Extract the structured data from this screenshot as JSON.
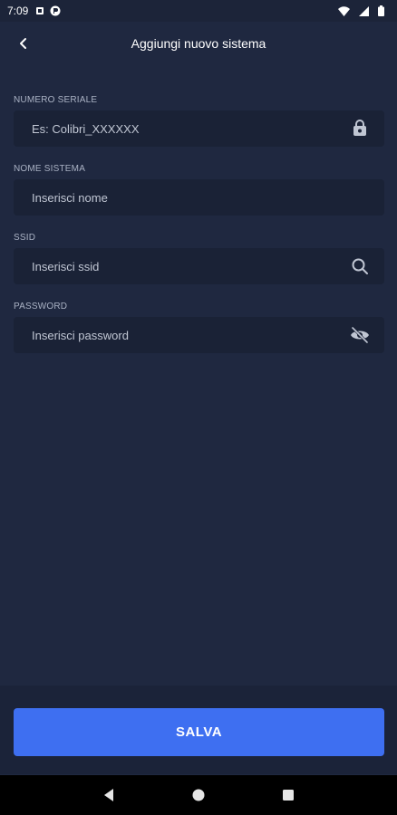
{
  "status_bar": {
    "time": "7:09",
    "icons": [
      "notification-icon",
      "app-icon",
      "wifi-icon",
      "signal-icon",
      "battery-icon"
    ]
  },
  "header": {
    "title": "Aggiungi nuovo sistema",
    "back_icon": "chevron-left-icon"
  },
  "fields": {
    "serial": {
      "label": "NUMERO SERIALE",
      "placeholder": "Es: Colibri_XXXXXX",
      "icon": "lock-icon"
    },
    "name": {
      "label": "NOME SISTEMA",
      "placeholder": "Inserisci nome"
    },
    "ssid": {
      "label": "SSID",
      "placeholder": "Inserisci ssid",
      "icon": "search-icon"
    },
    "password": {
      "label": "PASSWORD",
      "placeholder": "Inserisci password",
      "icon": "eye-off-icon"
    }
  },
  "actions": {
    "save_label": "SALVA"
  },
  "colors": {
    "background": "#1f2840",
    "field_background": "#1a2236",
    "accent": "#3e6ff1",
    "label": "#aab2c4"
  }
}
